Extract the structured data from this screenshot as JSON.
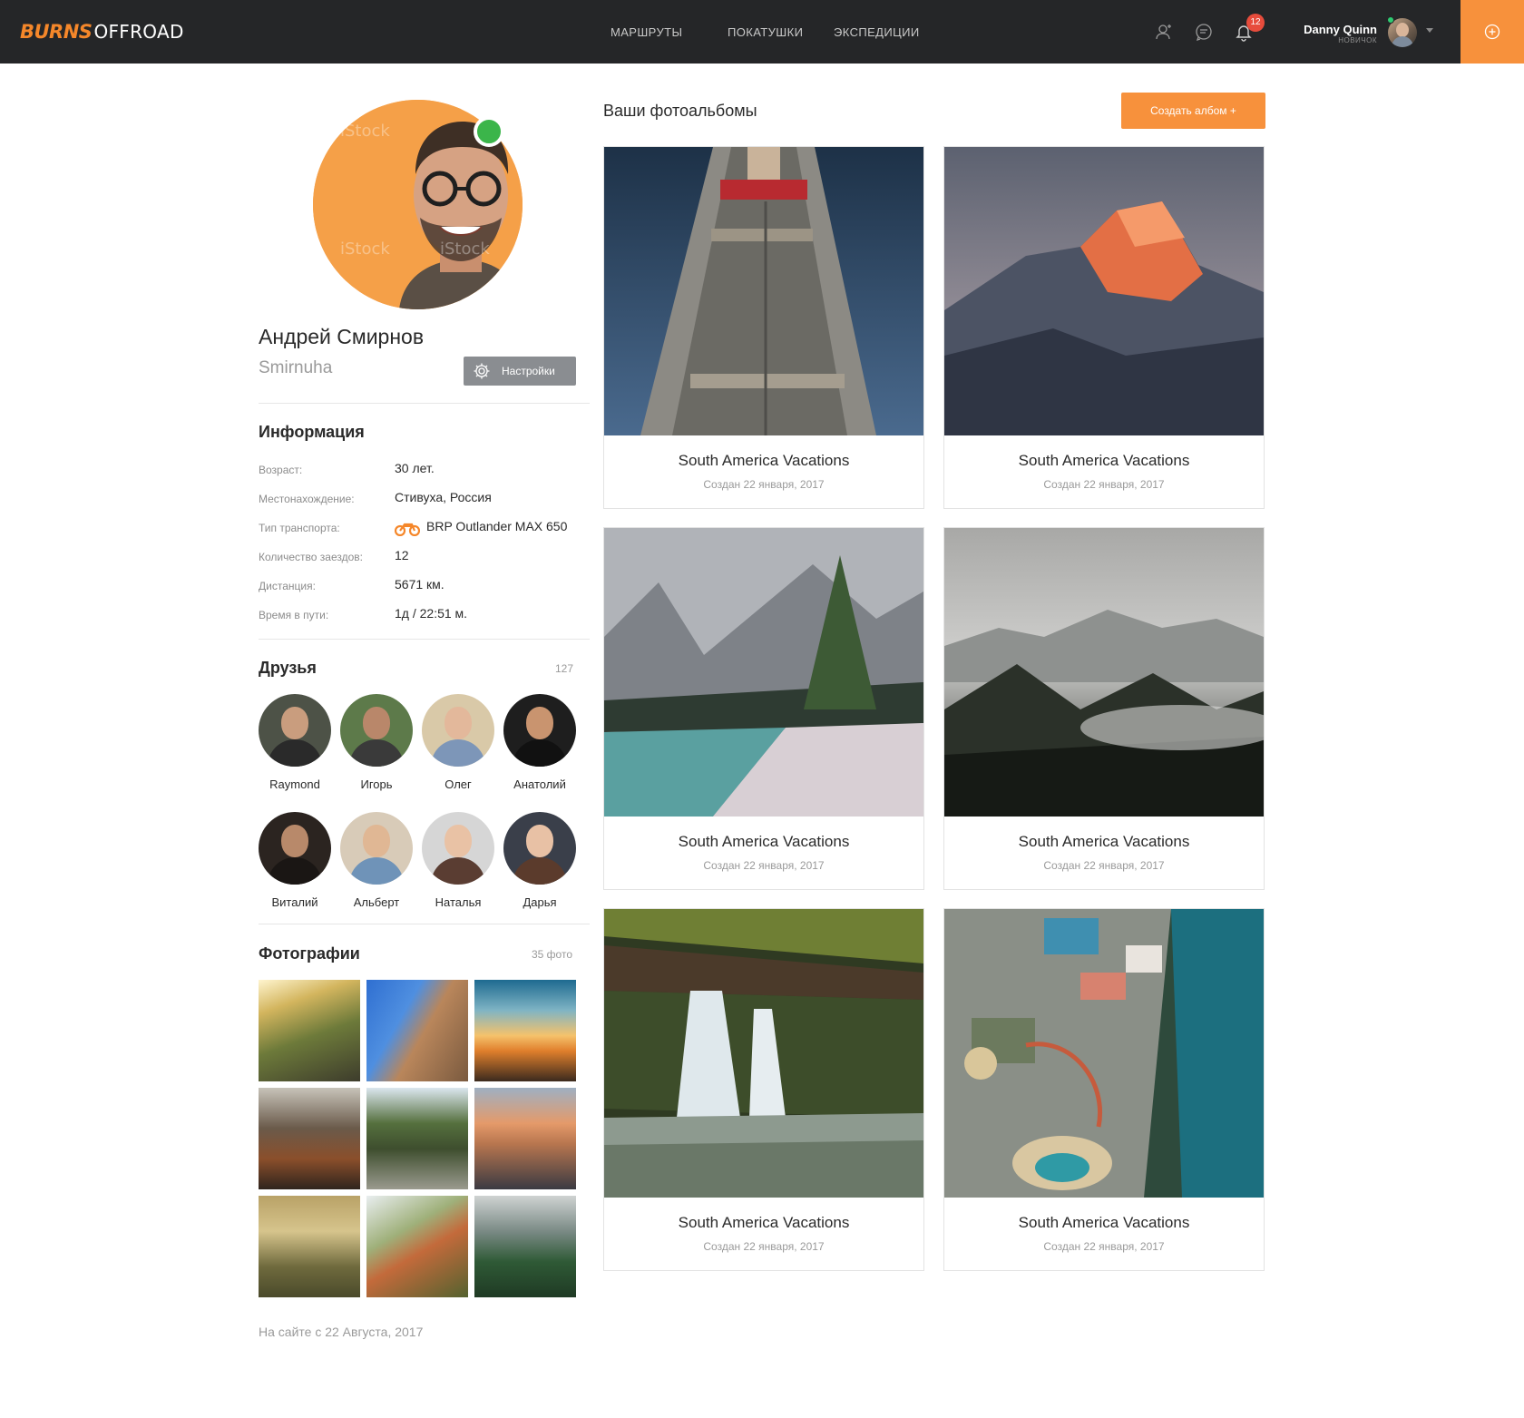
{
  "header": {
    "logo_brand": "BURNS",
    "logo_sub": "OFFROAD",
    "nav": [
      "МАРШРУТЫ",
      "ПОКАТУШКИ",
      "ЭКСПЕДИЦИИ"
    ],
    "notifications_count": "12",
    "user_name": "Danny Quinn",
    "user_role": "НОВИЧОК",
    "icons": [
      "user-icon",
      "chat-icon",
      "bell-icon",
      "plus-circle-icon"
    ],
    "accent_color": "#f7913c"
  },
  "profile": {
    "name": "Андрей Смирнов",
    "nickname": "Smirnuha",
    "settings_label": "Настройки",
    "online": true
  },
  "info": {
    "title": "Информация",
    "rows": [
      {
        "label": "Возраст:",
        "value": "30 лет."
      },
      {
        "label": "Местонахождение:",
        "value": "Стивуха, Россия"
      },
      {
        "label": "Тип транспорта:",
        "value": "BRP Outlander MAX 650"
      },
      {
        "label": "Количество заездов:",
        "value": "12"
      },
      {
        "label": "Дистанция:",
        "value": "5671 км."
      },
      {
        "label": "Время в пути:",
        "value": "1д / 22:51 м."
      }
    ]
  },
  "friends": {
    "title": "Друзья",
    "count": "127",
    "list": [
      {
        "name": "Raymond"
      },
      {
        "name": "Игорь"
      },
      {
        "name": "Олег"
      },
      {
        "name": "Анатолий"
      },
      {
        "name": "Виталий"
      },
      {
        "name": "Альберт"
      },
      {
        "name": "Наталья"
      },
      {
        "name": "Дарья"
      }
    ]
  },
  "photos": {
    "title": "Фотографии",
    "count": "35 фото"
  },
  "footer": {
    "member_since": "На сайте с 22 Августа, 2017"
  },
  "albums": {
    "title": "Ваши фотоальбомы",
    "create_label": "Создать албом +",
    "items": [
      {
        "title": "South America Vacations",
        "date": "Создан 22 января, 2017"
      },
      {
        "title": "South America Vacations",
        "date": "Создан 22 января, 2017"
      },
      {
        "title": "South America Vacations",
        "date": "Создан 22 января, 2017"
      },
      {
        "title": "South America Vacations",
        "date": "Создан 22 января, 2017"
      },
      {
        "title": "South America Vacations",
        "date": "Создан 22 января, 2017"
      },
      {
        "title": "South America Vacations",
        "date": "Создан 22 января, 2017"
      }
    ]
  }
}
